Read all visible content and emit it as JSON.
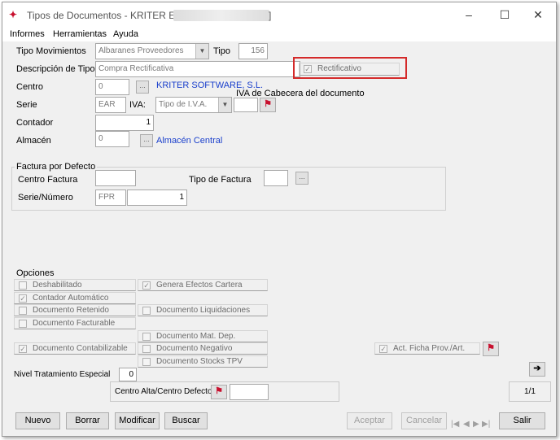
{
  "window": {
    "title": "Tipos de Documentos - KRITER ERP - [",
    "title_suffix": "]",
    "controls": {
      "minimize": "–",
      "maximize": "☐",
      "close": "✕"
    }
  },
  "menu": {
    "items": [
      "Informes",
      "Herramientas",
      "Ayuda"
    ]
  },
  "form": {
    "tipo_movimientos": {
      "label": "Tipo Movimientos",
      "value": "Albaranes Proveedores"
    },
    "tipo": {
      "label": "Tipo",
      "value": "156"
    },
    "descripcion": {
      "label": "Descripción de Tipo",
      "value": "Compra Rectificativa"
    },
    "rectificativo": {
      "label": "Rectificativo",
      "checked": true
    },
    "centro": {
      "label": "Centro",
      "value": "0",
      "name": "KRITER SOFTWARE, S.L."
    },
    "iva_cabecera_label": "IVA de Cabecera del documento",
    "serie": {
      "label": "Serie",
      "value": "EAR"
    },
    "iva": {
      "label": "IVA:",
      "value": "Tipo de I.V.A."
    },
    "contador": {
      "label": "Contador",
      "value": "1"
    },
    "almacen": {
      "label": "Almacén",
      "value": "0",
      "name": "Almacén Central"
    }
  },
  "factura": {
    "title": "Factura por Defecto",
    "centro_factura": {
      "label": "Centro Factura",
      "value": ""
    },
    "tipo_factura": {
      "label": "Tipo de Factura",
      "value": ""
    },
    "serie_numero": {
      "label": "Serie/Número",
      "serie": "FPR",
      "numero": "1"
    }
  },
  "opciones": {
    "title": "Opciones",
    "deshabilitado": {
      "label": "Deshabilitado",
      "checked": false
    },
    "genera_efectos": {
      "label": "Genera Efectos Cartera",
      "checked": true
    },
    "contador_automatico": {
      "label": "Contador Automático",
      "checked": true
    },
    "documento_retenido": {
      "label": "Documento Retenido",
      "checked": false
    },
    "documento_liquidaciones": {
      "label": "Documento Liquidaciones",
      "checked": false
    },
    "documento_facturable": {
      "label": "Documento Facturable",
      "checked": false
    },
    "documento_mat_dep": {
      "label": "Documento Mat. Dep.",
      "checked": false
    },
    "documento_contabilizable": {
      "label": "Documento Contabilizable",
      "checked": true
    },
    "documento_negativo": {
      "label": "Documento Negativo",
      "checked": false
    },
    "documento_stocks_tpv": {
      "label": "Documento Stocks TPV",
      "checked": false
    },
    "act_ficha": {
      "label": "Act. Ficha Prov./Art.",
      "checked": true
    },
    "nivel_tratamiento": {
      "label": "Nivel Tratamiento Especial",
      "value": "0"
    }
  },
  "centro_alta": {
    "label": "Centro Alta/Centro Defecto",
    "value": ""
  },
  "record_counter": "1/1",
  "buttons": {
    "nuevo": "Nuevo",
    "borrar": "Borrar",
    "modificar": "Modificar",
    "buscar": "Buscar",
    "aceptar": "Aceptar",
    "cancelar": "Cancelar",
    "salir": "Salir"
  },
  "nav": {
    "first": "|◀",
    "prev": "◀",
    "next": "▶",
    "last": "▶|"
  },
  "colors": {
    "link": "#1a3fcc",
    "highlight": "#d42a2a",
    "icon_red": "#c8102e"
  }
}
